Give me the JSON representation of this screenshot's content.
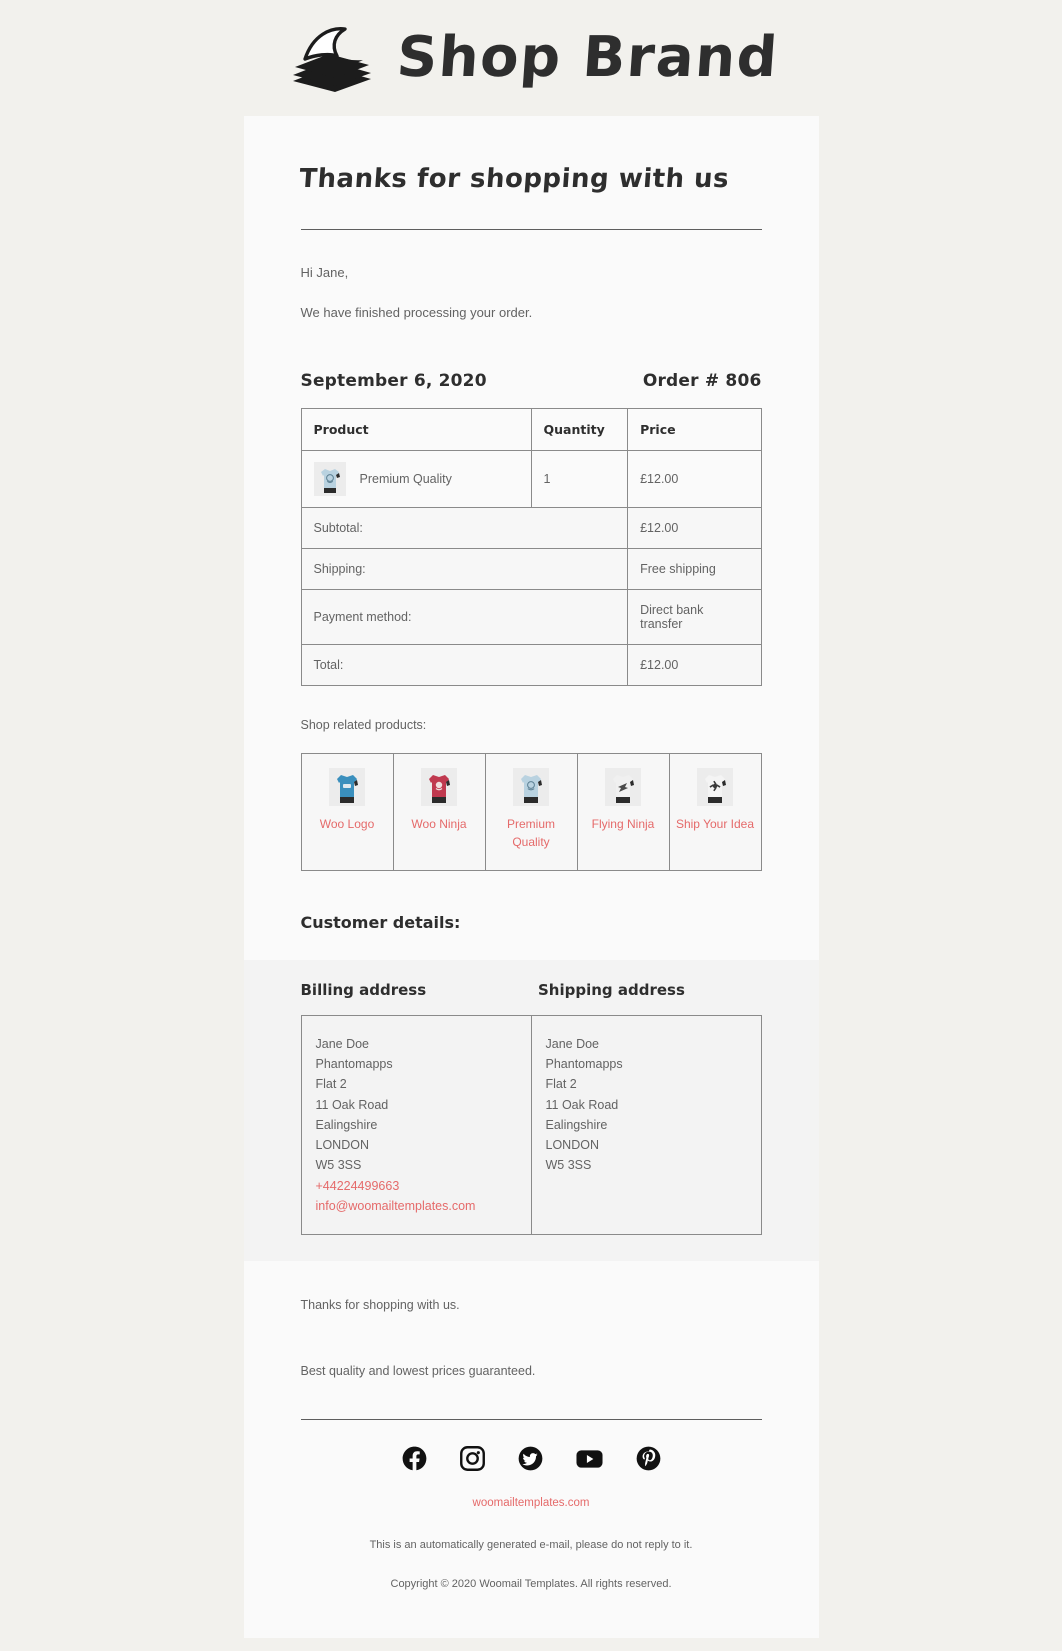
{
  "brand": {
    "name": "Shop Brand",
    "logo_icon": "stacked-papers-icon"
  },
  "email": {
    "title": "Thanks for shopping with us",
    "greeting": "Hi Jane,",
    "intro": "We have finished processing your order."
  },
  "order": {
    "date": "September 6, 2020",
    "number_label": "Order # 806",
    "columns": {
      "product": "Product",
      "quantity": "Quantity",
      "price": "Price"
    },
    "items": [
      {
        "name": "Premium Quality",
        "quantity": "1",
        "price": "£12.00",
        "thumb_color": "#b9d2e0"
      }
    ],
    "totals": [
      {
        "label": "Subtotal:",
        "value": "£12.00"
      },
      {
        "label": "Shipping:",
        "value": "Free shipping"
      },
      {
        "label": "Payment method:",
        "value": "Direct bank transfer"
      },
      {
        "label": "Total:",
        "value": "£12.00"
      }
    ]
  },
  "related": {
    "caption": "Shop related products:",
    "products": [
      {
        "name": "Woo Logo",
        "thumb_color": "#3a8fbd"
      },
      {
        "name": "Woo Ninja",
        "thumb_color": "#c0394f"
      },
      {
        "name": "Premium Quality",
        "thumb_color": "#b9d2e0"
      },
      {
        "name": "Flying Ninja",
        "thumb_color": "#e8e8e8"
      },
      {
        "name": "Ship Your Idea",
        "thumb_color": "#efefef"
      }
    ]
  },
  "customer": {
    "heading": "Customer details:",
    "billing": {
      "heading": "Billing address",
      "lines": [
        "Jane Doe",
        "Phantomapps",
        "Flat 2",
        "11 Oak Road",
        "Ealingshire",
        "LONDON",
        "W5 3SS"
      ],
      "phone": "+44224499663",
      "email": "info@woomailtemplates.com"
    },
    "shipping": {
      "heading": "Shipping address",
      "lines": [
        "Jane Doe",
        "Phantomapps",
        "Flat 2",
        "11 Oak Road",
        "Ealingshire",
        "LONDON",
        "W5 3SS"
      ]
    }
  },
  "closing": {
    "line1": "Thanks for shopping with us.",
    "line2": "Best quality and lowest prices guaranteed."
  },
  "footer": {
    "social": [
      {
        "name": "facebook",
        "label": "Facebook"
      },
      {
        "name": "instagram",
        "label": "Instagram"
      },
      {
        "name": "twitter",
        "label": "Twitter"
      },
      {
        "name": "youtube",
        "label": "YouTube"
      },
      {
        "name": "pinterest",
        "label": "Pinterest"
      }
    ],
    "site": "woomailtemplates.com",
    "note": "This is an automatically generated e-mail, please do not reply to it.",
    "copyright": "Copyright © 2020 Woomail Templates. All rights reserved."
  },
  "colors": {
    "accent": "#e56a6a",
    "page_bg": "#f2f1ed",
    "card_bg": "#fafafa",
    "band_bg": "#f3f3f3",
    "text": "#636363",
    "heading": "#2e2e2e"
  }
}
